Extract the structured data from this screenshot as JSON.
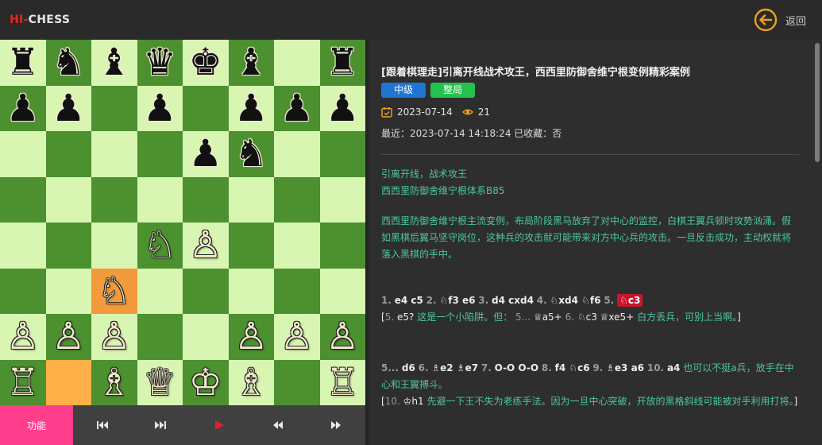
{
  "header": {
    "logo_hi": "HI-",
    "logo_chess": "CHESS",
    "back_label": "返回"
  },
  "board": {
    "squares": [
      [
        "♜",
        "♞",
        "♝",
        "♛",
        "♚",
        "♝",
        "",
        "♜"
      ],
      [
        "♟",
        "♟",
        "",
        "♟",
        "",
        "♟",
        "♟",
        "♟"
      ],
      [
        "",
        "",
        "",
        "",
        "♟",
        "♞",
        "",
        ""
      ],
      [
        "",
        "",
        "",
        "",
        "",
        "",
        "",
        ""
      ],
      [
        "",
        "",
        "",
        "♘",
        "♙",
        "",
        "",
        ""
      ],
      [
        "",
        "",
        "♘",
        "",
        "",
        "",
        "",
        ""
      ],
      [
        "♙",
        "♙",
        "♙",
        "",
        "",
        "♙",
        "♙",
        "♙"
      ],
      [
        "♖",
        "",
        "♗",
        "♕",
        "♔",
        "♗",
        "",
        "♖"
      ]
    ],
    "highlight_from": [
      7,
      1
    ],
    "highlight_to": [
      5,
      2
    ],
    "light_color": "#d8f5b1",
    "dark_color": "#4c9030"
  },
  "controls": {
    "function_label": "功能",
    "buttons": [
      "first-move",
      "last-move",
      "play",
      "previous-move",
      "next-move"
    ]
  },
  "article": {
    "title": "[跟着棋理走]引离开线战术攻王，西西里防御舍维宁根变例精彩案例",
    "tag_level": "中级",
    "tag_stage": "整局",
    "date": "2023-07-14",
    "views": "21",
    "recent": "最近：2023-07-14 14:18:24 已收藏：否",
    "desc_line1": "引离开线，战术攻王",
    "desc_line2": "西西里防御舍维宁根体系B85",
    "desc_para": "西西里防御舍维宁根主流变例，布局阶段黑马放弃了对中心的监控，白棋王翼兵顿时攻势汹涌。假如黑棋后翼马坚守岗位，这种兵的攻击就可能带来对方中心兵的攻击。一旦反击成功，主动权就将落入黑棋的手中。"
  },
  "moves": {
    "line1": {
      "n1": "1.",
      "m1": "e4 c5",
      "n2": "2.",
      "m2": "♘f3 e6",
      "n3": "3.",
      "m3": "d4 cxd4",
      "n4": "4.",
      "m4": "♘xd4 ♘f6",
      "n5": "5.",
      "m5": "♘c3"
    },
    "var1": {
      "open": "[",
      "n": "5.",
      "m": "e5?",
      "comment": "这是一个小陷阱。但：",
      "n2": "5...",
      "m2": "♕a5+",
      "n3": "6.",
      "m3": "♘c3 ♕xe5+",
      "comment2": "白方丢兵，可别上当啊。",
      "close": "]"
    },
    "line2": {
      "n5": "5...",
      "m5": "d6",
      "n6": "6.",
      "m6": "♗e2 ♗e7",
      "n7": "7.",
      "m7": "O-O O-O",
      "n8": "8.",
      "m8": "f4 ♘c6",
      "n9": "9.",
      "m9": "♗e3 a6",
      "n10": "10.",
      "m10": "a4",
      "comment": "也可以不挺a兵，放手在中心和王翼搏斗。"
    },
    "var2": {
      "open": "[",
      "n": "10.",
      "m": "♔h1",
      "comment": "先避一下王不失为老练手法。因为一旦中心突破，开放的黑格斜线可能被对手利用打将。",
      "close": "]"
    }
  },
  "colors": {
    "accent_orange": "#f0a020",
    "pink": "#ff3d8d",
    "comment_teal": "#4cc6a4",
    "current_move_red": "#c8162b"
  }
}
